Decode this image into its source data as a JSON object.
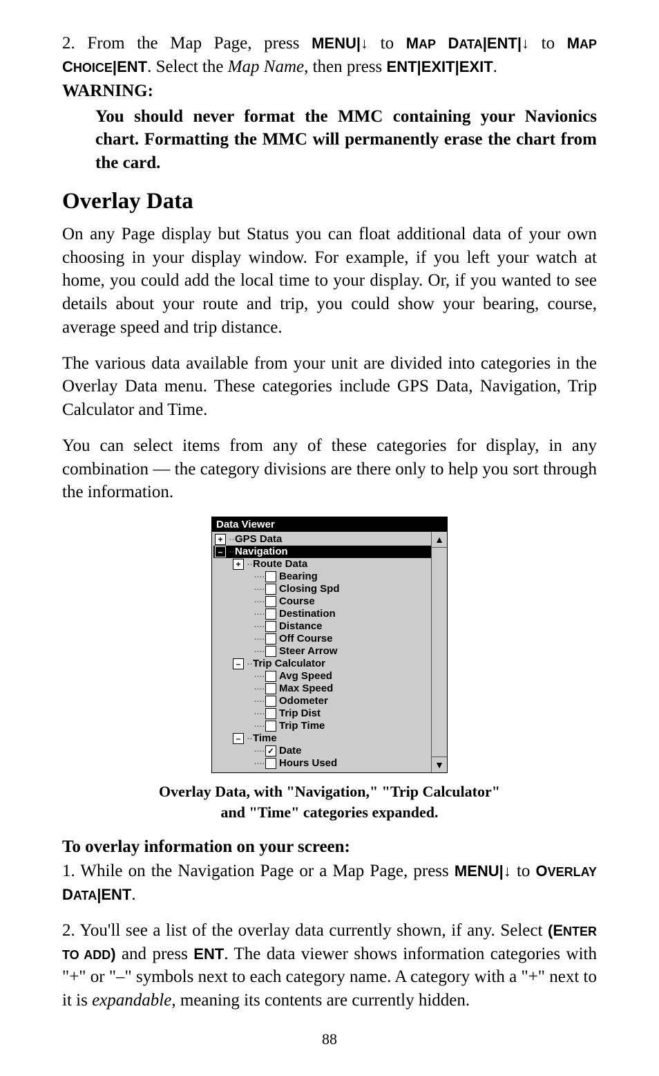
{
  "p1": {
    "pre": "2. From the Map Page, press ",
    "k1": "MENU",
    "sep": "|",
    "arrow": "↓",
    "mid1": " to ",
    "k2a": "M",
    "k2b": "AP",
    "k2c": " D",
    "k2d": "ATA",
    "k3": "ENT",
    "mid2": " to ",
    "k4a": "M",
    "k4b": "AP",
    "line2a": "C",
    "line2b": "HOICE",
    "line2c": "ENT",
    "line2mid": ". Select the ",
    "italic": "Map Name",
    "line2mid2": ", then press ",
    "k5": "ENT",
    "k6": "EXIT",
    "k7": "EXIT",
    "end": "."
  },
  "warning": {
    "head": "WARNING:",
    "body": "You should never format the MMC containing your Navionics chart. Formatting the MMC will permanently erase the chart from the card."
  },
  "overlay": {
    "heading": "Overlay Data",
    "p1": "On any Page display but Status you can float additional data of your own choosing in your display window. For example, if you left your watch at home, you could add the local time to your display. Or, if you wanted to see details about your route and trip, you could show your bearing, course, average speed and trip distance.",
    "p2": "The various data available from your unit are divided into categories in the Overlay Data menu. These categories include GPS Data, Navigation, Trip Calculator and Time.",
    "p3": "You can select items from any of these categories for display, in any combination — the category divisions are there only to help you sort through the information."
  },
  "dataviewer": {
    "title": "Data Viewer",
    "scroll_up": "▲",
    "scroll_down": "▼",
    "nodes": {
      "gps_data": {
        "icon": "+",
        "label": "GPS Data"
      },
      "navigation": {
        "icon": "–",
        "label": "Navigation"
      },
      "route_data": {
        "icon": "+",
        "label": "Route Data"
      },
      "bearing": {
        "label": "Bearing"
      },
      "closing_spd": {
        "label": "Closing Spd"
      },
      "course": {
        "label": "Course"
      },
      "destination": {
        "label": "Destination"
      },
      "distance": {
        "label": "Distance"
      },
      "off_course": {
        "label": "Off Course"
      },
      "steer_arrow": {
        "label": "Steer Arrow"
      },
      "trip_calc": {
        "icon": "–",
        "label": "Trip Calculator"
      },
      "avg_speed": {
        "label": "Avg Speed"
      },
      "max_speed": {
        "label": "Max Speed"
      },
      "odometer": {
        "label": "Odometer"
      },
      "trip_dist": {
        "label": "Trip Dist"
      },
      "trip_time": {
        "label": "Trip Time"
      },
      "time": {
        "icon": "–",
        "label": "Time"
      },
      "date": {
        "label": "Date"
      },
      "hours_used": {
        "label": "Hours Used"
      }
    }
  },
  "caption": {
    "l1": "Overlay Data, with \"Navigation,\" \"Trip Calculator\"",
    "l2": "and \"Time\" categories expanded."
  },
  "howto": {
    "head": "To overlay information on your screen:",
    "s1a": "1. While on the Navigation Page or a Map Page, press ",
    "s1k1": "MENU",
    "s1sep": "|",
    "s1arrow": "↓",
    "s1mid": " to ",
    "s1k2a": "O",
    "s1k2b": "VERLAY",
    "s1k2c": " D",
    "s1k2d": "ATA",
    "s1k3": "ENT",
    "s1end": ".",
    "s2a": "2. You'll see a list of the overlay data currently shown, if any. Select ",
    "s2k1a": "(E",
    "s2k1b": "NTER",
    "s2k1c": " TO",
    "s2k1d": " ADD",
    "s2k1e": ")",
    "s2mid1": " and press ",
    "s2k2": "ENT",
    "s2mid2": ". The data viewer shows information categories with \"+\" or \"–\" symbols next to each category name. A category with a \"+\" next to it is ",
    "s2italic": "expandable",
    "s2end": ", meaning its contents are currently hidden."
  },
  "page_number": "88"
}
